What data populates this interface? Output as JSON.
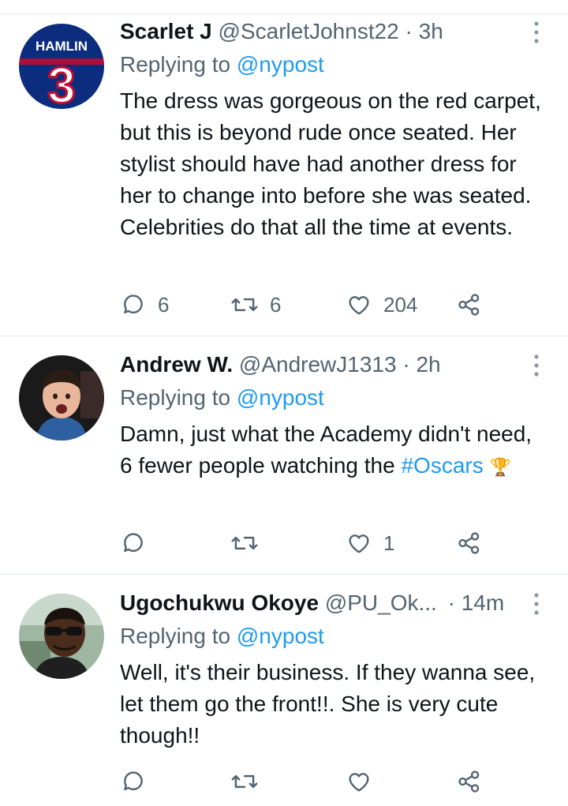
{
  "tweets": [
    {
      "name": "Scarlet J",
      "handle": "@ScarletJohnst22",
      "separator": " · ",
      "time": "3h",
      "replying_prefix": "Replying to ",
      "replying_to": "@nypost",
      "avatar_text": "HAMLIN",
      "avatar_number": "3",
      "text": "The dress was gorgeous on the red carpet, but this is beyond rude once seated. Her stylist should have had another dress for her to change into before she was seated. Celebrities do that all the time at events.",
      "reply_count": "6",
      "retweet_count": "6",
      "like_count": "204"
    },
    {
      "name": "Andrew W.",
      "handle": "@AndrewJ1313",
      "separator": " · ",
      "time": "2h",
      "replying_prefix": "Replying to ",
      "replying_to": "@nypost",
      "text": "Damn, just what the Academy didn't need, 6 fewer people watching the",
      "hashtag": "#Oscars",
      "emoji": "🏆",
      "reply_count": "",
      "retweet_count": "",
      "like_count": "1"
    },
    {
      "name": "Ugochukwu Okoye",
      "handle": "@PU_Ok...",
      "separator": " · ",
      "time": "14m",
      "replying_prefix": "Replying to ",
      "replying_to": "@nypost",
      "text": "Well, it's their business. If they wanna see, let them go the front!!. She is very cute though!!",
      "reply_count": "",
      "retweet_count": "",
      "like_count": ""
    }
  ],
  "colors": {
    "text_primary": "#0f1419",
    "text_secondary": "#536471",
    "link": "#1d9bf0",
    "divider": "#e4e8eb"
  },
  "icons": [
    "reply-icon",
    "retweet-icon",
    "like-icon",
    "share-icon",
    "more-options-icon"
  ]
}
